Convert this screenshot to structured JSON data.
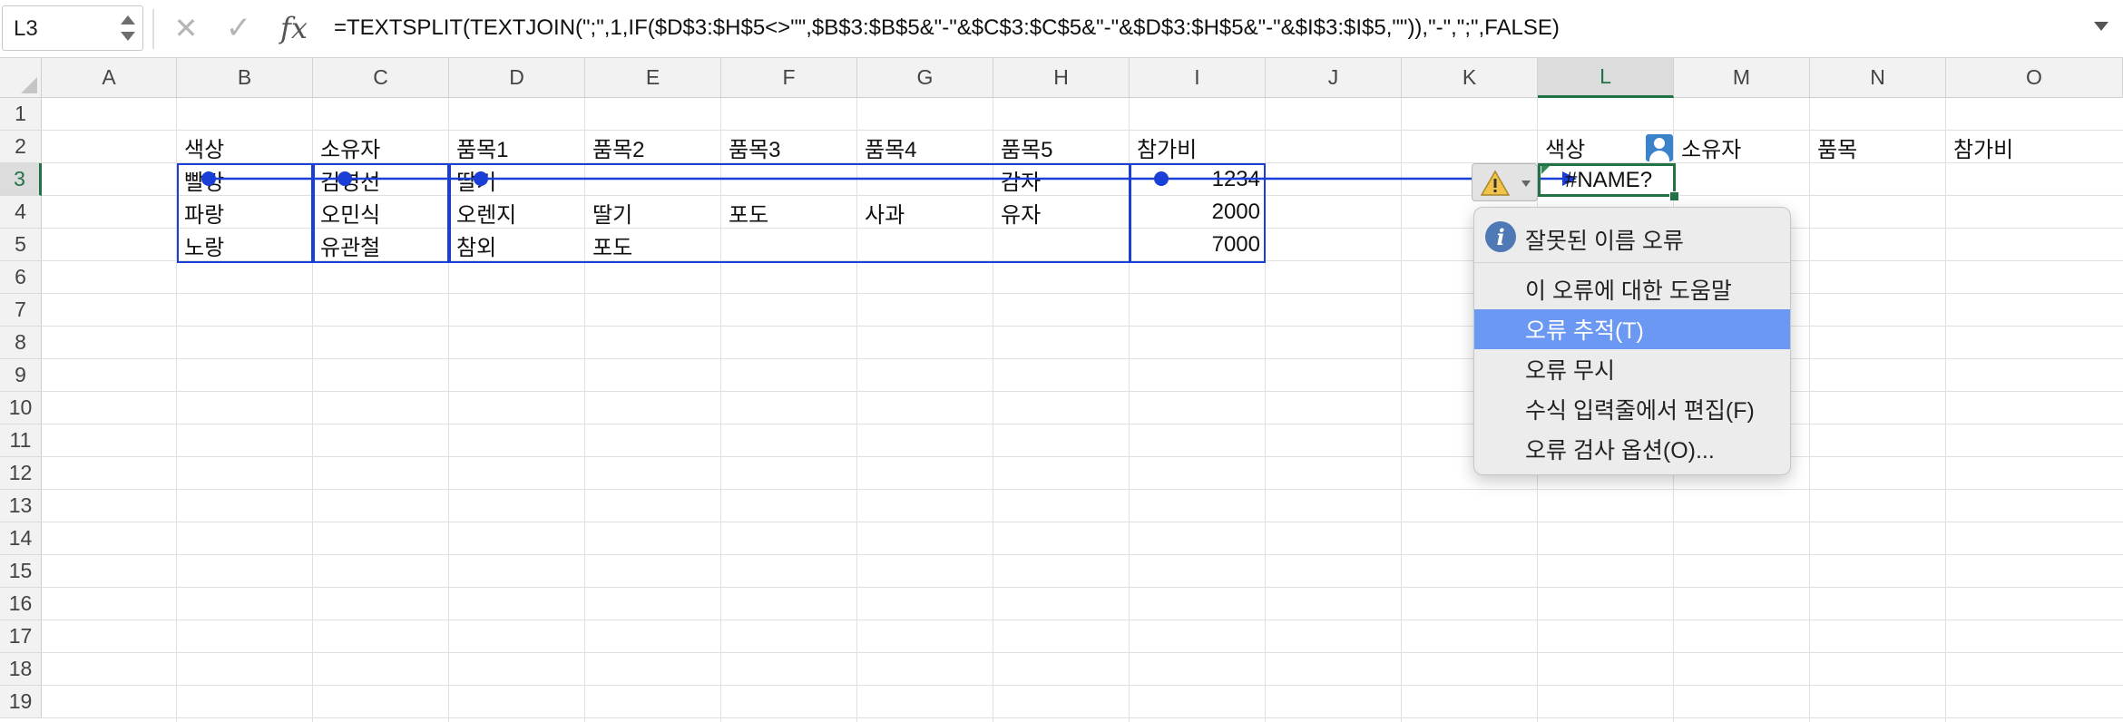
{
  "formula_bar": {
    "name_box": "L3",
    "cancel_glyph": "✕",
    "enter_glyph": "✓",
    "fx_label": "fx",
    "formula": "=TEXTSPLIT(TEXTJOIN(\";\",1,IF($D$3:$H$5<>\"\",$B$3:$B$5&\"-\"&$C$3:$C$5&\"-\"&$D$3:$H$5&\"-\"&$I$3:$I$5,\"\")),\"-\",\";\",FALSE)"
  },
  "columns": [
    "A",
    "B",
    "C",
    "D",
    "E",
    "F",
    "G",
    "H",
    "I",
    "J",
    "K",
    "L",
    "M",
    "N",
    "O"
  ],
  "rows": [
    "1",
    "2",
    "3",
    "4",
    "5",
    "6",
    "7",
    "8",
    "9",
    "10",
    "11",
    "12",
    "13",
    "14",
    "15",
    "16",
    "17",
    "18",
    "19"
  ],
  "selected": {
    "column": "L",
    "row": "3"
  },
  "table": {
    "headers": [
      "색상",
      "소유자",
      "품목1",
      "품목2",
      "품목3",
      "품목4",
      "품목5",
      "참가비"
    ],
    "rows": [
      [
        "빨강",
        "김영선",
        "딸기",
        "",
        "",
        "",
        "감자",
        "1234"
      ],
      [
        "파랑",
        "오민식",
        "오렌지",
        "딸기",
        "포도",
        "사과",
        "유자",
        "2000"
      ],
      [
        "노랑",
        "유관철",
        "참외",
        "포도",
        "",
        "",
        "",
        "7000"
      ]
    ]
  },
  "result_headers": [
    "색상",
    "소유자",
    "품목",
    "참가비"
  ],
  "result_value": "#NAME?",
  "icons": {
    "warning": "warning-icon",
    "info": "info-icon",
    "person": "person-icon"
  },
  "colors": {
    "accent": "#217346",
    "tracer": "#1a3fd6",
    "menu_highlight": "#6b98f2"
  },
  "error_menu": {
    "title": "잘못된 이름 오류",
    "items": [
      {
        "label": "이 오류에 대한 도움말",
        "highlighted": false
      },
      {
        "label": "오류 추적(T)",
        "highlighted": true
      },
      {
        "label": "오류 무시",
        "highlighted": false
      },
      {
        "label": "수식 입력줄에서 편집(F)",
        "highlighted": false
      },
      {
        "label": "오류 검사 옵션(O)...",
        "highlighted": false
      }
    ]
  }
}
